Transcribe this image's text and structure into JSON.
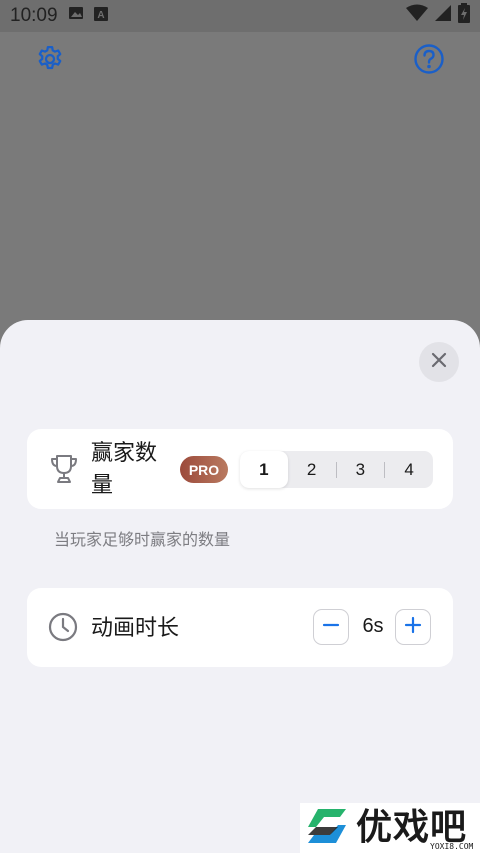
{
  "status_bar": {
    "time": "10:09",
    "icons": [
      "image-icon",
      "a-badge-icon",
      "wifi-icon",
      "signal-icon",
      "battery-icon"
    ]
  },
  "top_bar": {
    "icons": [
      "gear-icon",
      "help-icon"
    ]
  },
  "sheet": {
    "winners_card": {
      "title": "赢家数量",
      "icon": "trophy-icon",
      "badge": "PRO",
      "options": [
        "1",
        "2",
        "3",
        "4"
      ],
      "selected": "1"
    },
    "winners_hint": "当玩家足够时赢家的数量",
    "duration_card": {
      "title": "动画时长",
      "icon": "clock-icon",
      "value": "6s"
    }
  },
  "watermark": {
    "text": "优戏吧",
    "sub": "YOXI8.COM"
  },
  "colors": {
    "accent": "#1a5fc8",
    "overlay": "#7a7a7a",
    "sheet_bg": "#f1f1f6",
    "pro_badge": "#a85c48"
  }
}
